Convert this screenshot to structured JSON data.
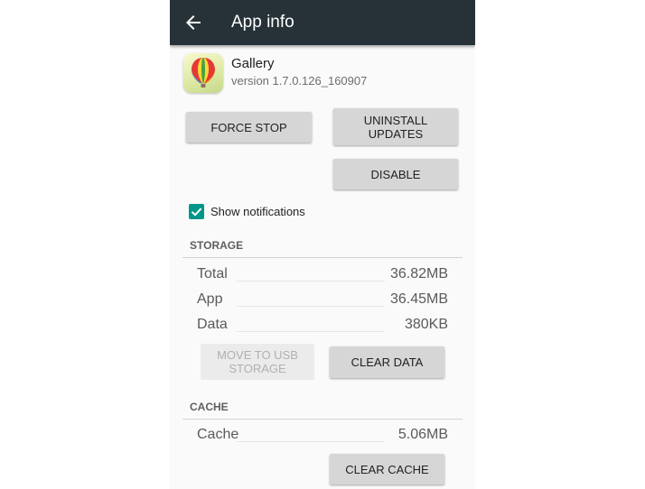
{
  "appbar": {
    "title": "App info",
    "back_icon": "arrow-back-icon"
  },
  "app": {
    "name": "Gallery",
    "version": "version 1.7.0.126_160907",
    "icon": "hot-air-balloon-icon"
  },
  "buttons": {
    "force_stop": "FORCE STOP",
    "uninstall_line1": "UNINSTALL",
    "uninstall_line2": "UPDATES",
    "disable": "DISABLE"
  },
  "notifications": {
    "label": "Show notifications",
    "checked": true
  },
  "storage": {
    "header": "STORAGE",
    "rows": [
      {
        "label": "Total",
        "value": "36.82MB"
      },
      {
        "label": "App",
        "value": "36.45MB"
      },
      {
        "label": "Data",
        "value": "380KB"
      }
    ],
    "move_line1": "MOVE TO USB",
    "move_line2": "STORAGE",
    "clear_data": "CLEAR DATA"
  },
  "cache": {
    "header": "CACHE",
    "rows": [
      {
        "label": "Cache",
        "value": "5.06MB"
      }
    ],
    "clear_cache": "CLEAR CACHE"
  },
  "colors": {
    "appbar": "#263238",
    "accent": "#009688",
    "button": "#d6d6d6"
  }
}
